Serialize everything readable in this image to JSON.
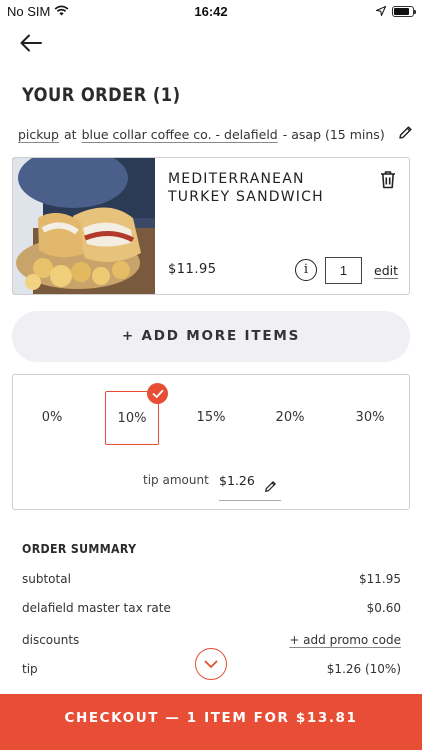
{
  "status_bar": {
    "carrier": "No SIM",
    "time": "16:42",
    "battery_level": 0.85
  },
  "header": {
    "title": "YOUR ORDER (1)"
  },
  "pickup": {
    "mode": "pickup",
    "at": "at",
    "location": "blue collar coffee co. - delafield",
    "timing": "- asap (15 mins)"
  },
  "item": {
    "name": "MEDITERRANEAN TURKEY SANDWICH",
    "price": "$11.95",
    "quantity": "1",
    "info_glyph": "i",
    "edit_label": "edit"
  },
  "add_more_label": "+ ADD MORE ITEMS",
  "tip": {
    "options": [
      "0%",
      "10%",
      "15%",
      "20%",
      "30%"
    ],
    "selected": "10%",
    "amount_label": "tip amount",
    "amount_value": "$1.26"
  },
  "summary": {
    "title": "ORDER SUMMARY",
    "rows": [
      {
        "label": "subtotal",
        "value": "$11.95"
      },
      {
        "label": "delafield master tax rate",
        "value": "$0.60"
      },
      {
        "label": "discounts",
        "value": "+ add promo code"
      },
      {
        "label": "tip",
        "value": "$1.26 (10%)"
      }
    ]
  },
  "checkout_label": "CHECKOUT — 1 ITEM FOR $13.81",
  "colors": {
    "accent": "#e84e35",
    "pill_bg": "#f0eff4",
    "border": "#cfcfcf"
  }
}
